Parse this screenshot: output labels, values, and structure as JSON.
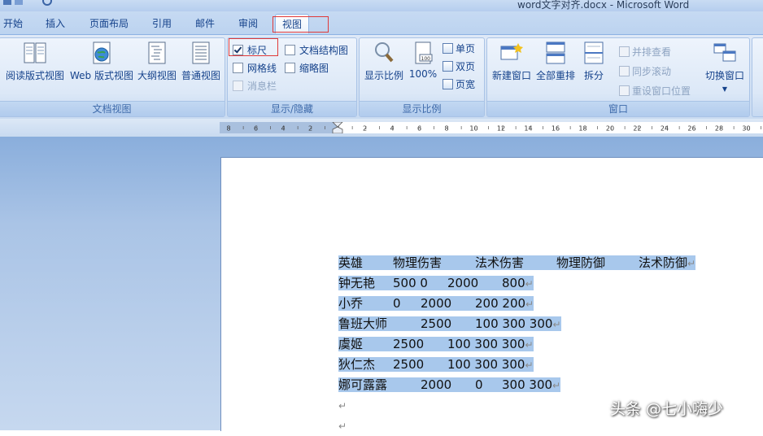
{
  "window": {
    "title": "word文字对齐.docx - Microsoft Word"
  },
  "tabs": [
    {
      "label": "开始"
    },
    {
      "label": "插入"
    },
    {
      "label": "页面布局"
    },
    {
      "label": "引用"
    },
    {
      "label": "邮件"
    },
    {
      "label": "审阅"
    },
    {
      "label": "视图",
      "active": true
    }
  ],
  "ribbon": {
    "doc_views": {
      "label": "文档视图",
      "buttons": [
        {
          "label": "阅读版式视图"
        },
        {
          "label": "Web 版式视图"
        },
        {
          "label": "大纲视图"
        },
        {
          "label": "普通视图"
        }
      ]
    },
    "show_hide": {
      "label": "显示/隐藏",
      "items": [
        {
          "label": "标尺",
          "checked": true
        },
        {
          "label": "文档结构图",
          "checked": false
        },
        {
          "label": "网格线",
          "checked": false
        },
        {
          "label": "缩略图",
          "checked": false
        },
        {
          "label": "消息栏",
          "checked": false,
          "disabled": true
        }
      ]
    },
    "zoom": {
      "label": "显示比例",
      "buttons": [
        {
          "label": "显示比例"
        },
        {
          "label": "100%"
        }
      ],
      "small": [
        {
          "label": "单页"
        },
        {
          "label": "双页"
        },
        {
          "label": "页宽"
        }
      ],
      "icon_text": "100"
    },
    "window": {
      "label": "窗口",
      "buttons": [
        {
          "label": "新建窗口"
        },
        {
          "label": "全部重排"
        },
        {
          "label": "拆分"
        }
      ],
      "small": [
        {
          "label": "并排查看"
        },
        {
          "label": "同步滚动"
        },
        {
          "label": "重设窗口位置"
        }
      ],
      "switch": {
        "label": "切换窗口"
      }
    }
  },
  "ruler": {
    "labels": [
      "8",
      "6",
      "4",
      "2",
      "2",
      "4",
      "6",
      "8",
      "10",
      "12",
      "14",
      "16",
      "18",
      "20",
      "22",
      "24",
      "26",
      "28",
      "30"
    ]
  },
  "document": {
    "rows": [
      {
        "cells": [
          "英雄",
          "物理伤害",
          "法术伤害",
          "物理防御",
          "法术防御"
        ]
      },
      {
        "cells": [
          "钟无艳",
          "500 0",
          "2000",
          "800"
        ]
      },
      {
        "cells": [
          "小乔",
          "0",
          "2000",
          "200 200"
        ]
      },
      {
        "cells": [
          "鲁班大师",
          "2500",
          "100 300 300"
        ]
      },
      {
        "cells": [
          "虞姬",
          "2500",
          "100 300 300"
        ]
      },
      {
        "cells": [
          "狄仁杰",
          "2500",
          "100 300 300"
        ]
      },
      {
        "cells": [
          "娜可露露",
          "2000",
          "0",
          "300 300"
        ]
      }
    ],
    "paragraph_mark": "↵"
  },
  "watermark": {
    "text": "头条 @七小嗨少"
  },
  "colors": {
    "selection": "#a8c8ec",
    "accent_box": "#e03a3a"
  }
}
